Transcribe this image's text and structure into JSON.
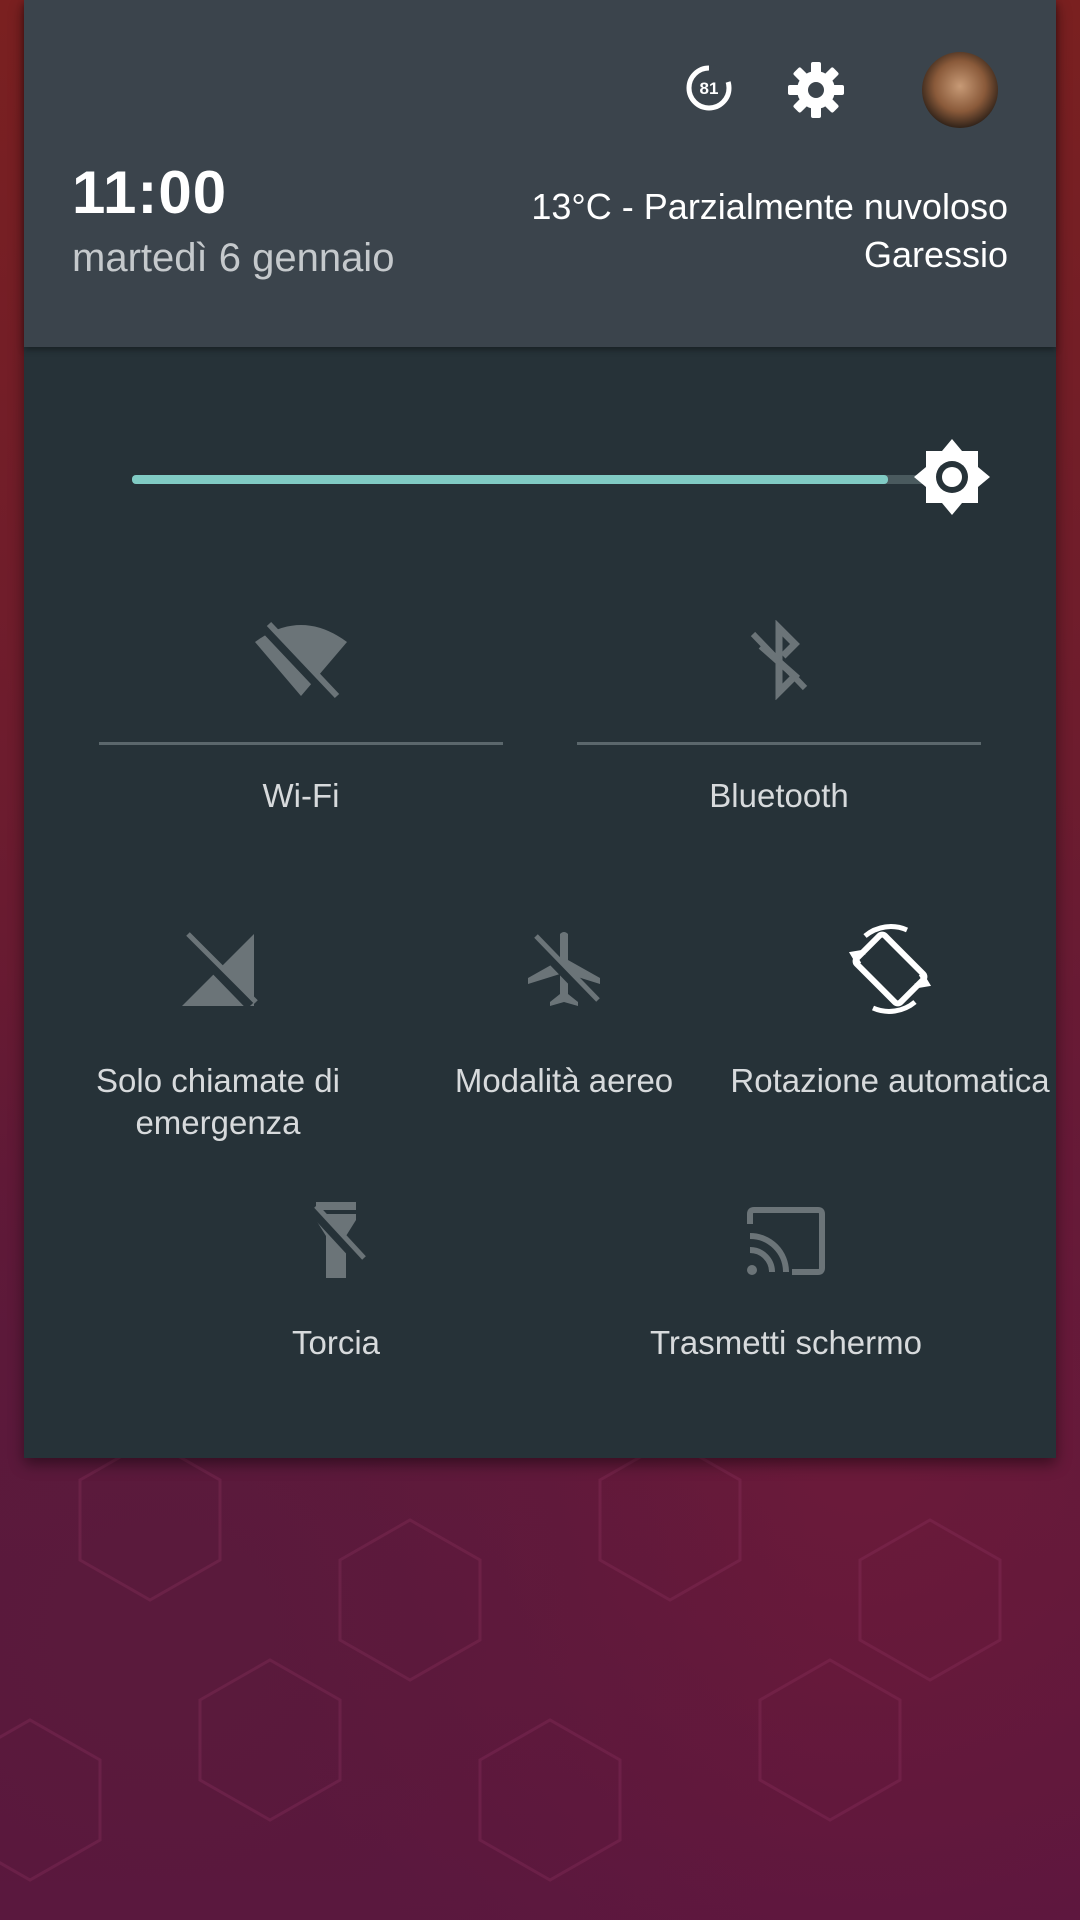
{
  "header": {
    "time": "11:00",
    "date": "martedì 6 gennaio",
    "weather": "13°C - Parzialmente nuvoloso",
    "location": "Garessio",
    "battery_level": "81"
  },
  "brightness": {
    "level": 0.92,
    "accent": "#80cbc4"
  },
  "tiles": {
    "wifi": {
      "label": "Wi-Fi",
      "icon": "wifi-off-icon"
    },
    "bluetooth": {
      "label": "Bluetooth",
      "icon": "bluetooth-disabled-icon"
    },
    "emergency": {
      "label_line1": "Solo chiamate di",
      "label_line2": "emergenza",
      "icon": "signal-off-icon"
    },
    "airplane": {
      "label": "Modalità aereo",
      "icon": "airplane-off-icon"
    },
    "rotation": {
      "label": "Rotazione automatica",
      "icon": "screen-rotation-icon"
    },
    "flashlight": {
      "label": "Torcia",
      "icon": "flashlight-off-icon"
    },
    "cast": {
      "label": "Trasmetti schermo",
      "icon": "cast-icon"
    }
  },
  "colors": {
    "panel": "#263238",
    "header": "#3b444c",
    "icon_inactive": "#6b7478",
    "icon_active": "#ffffff"
  }
}
